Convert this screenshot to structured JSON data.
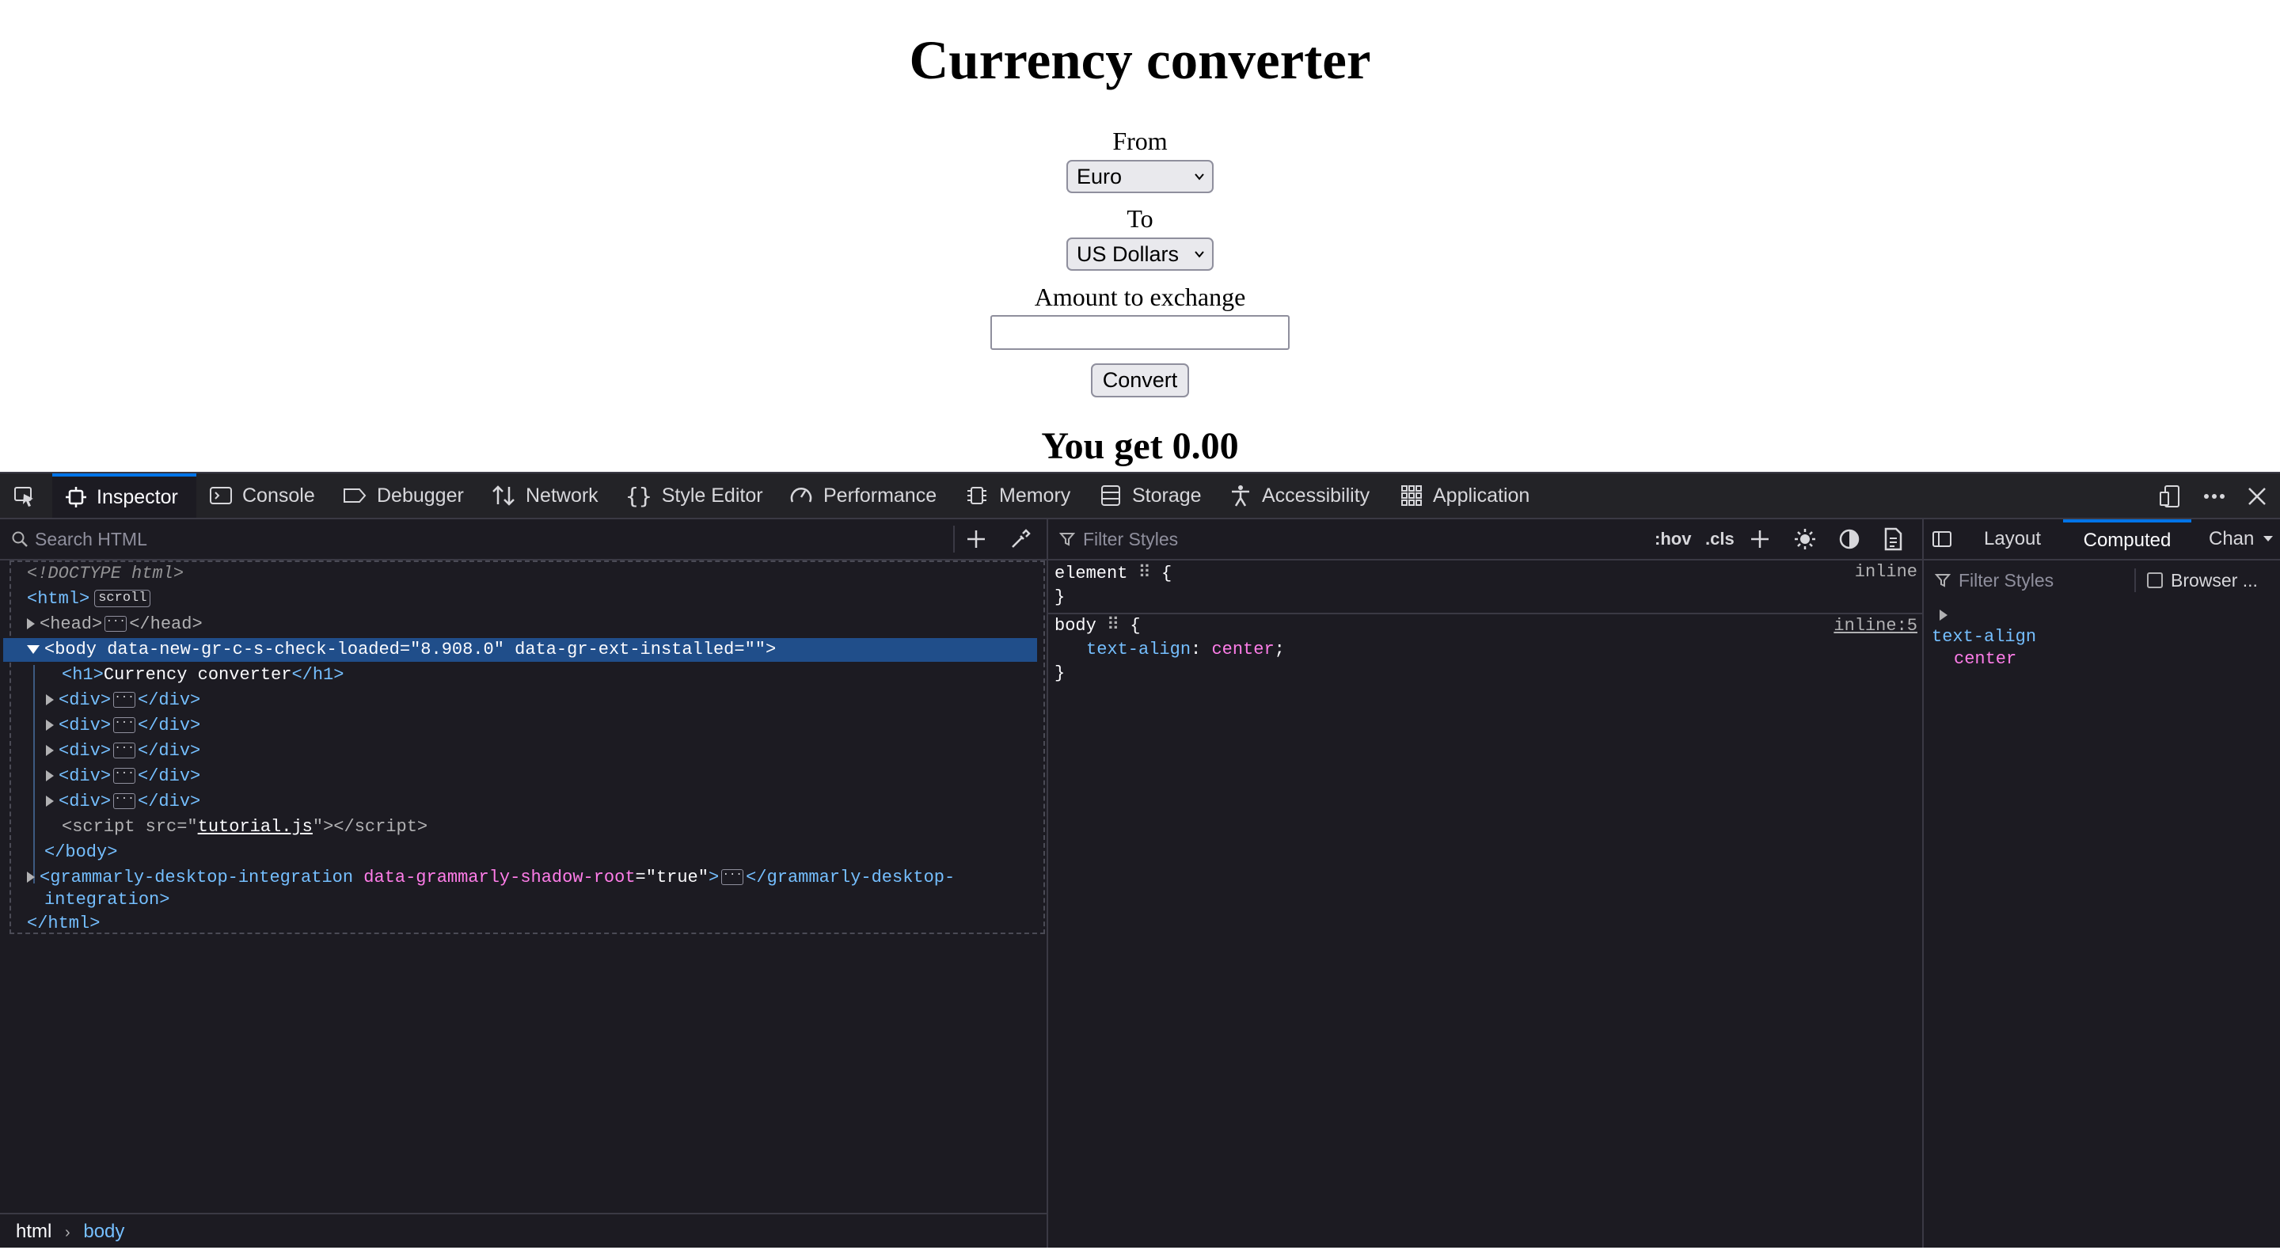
{
  "page": {
    "title": "Currency converter",
    "from_label": "From",
    "from_value": "Euro",
    "to_label": "To",
    "to_value": "US Dollars",
    "amount_label": "Amount to exchange",
    "amount_value": "",
    "convert_label": "Convert",
    "result": "You get 0.00"
  },
  "devtools": {
    "tabs": [
      "Inspector",
      "Console",
      "Debugger",
      "Network",
      "Style Editor",
      "Performance",
      "Memory",
      "Storage",
      "Accessibility",
      "Application"
    ],
    "active_tab": "Inspector",
    "search_placeholder": "Search HTML",
    "tree": {
      "doctype": "<!DOCTYPE html>",
      "html_tag": "html",
      "scroll_badge": "scroll",
      "head_tag": "head",
      "body_tag": "body",
      "body_attr1_name": "data-new-gr-c-s-check-loaded",
      "body_attr1_value": "8.908.0",
      "body_attr2_name": "data-gr-ext-installed",
      "body_attr2_value": "",
      "h1_tag": "h1",
      "h1_text": "Currency converter",
      "div_tag": "div",
      "script_tag": "script",
      "script_attr": "src",
      "script_src": "tutorial.js",
      "gram_tag": "grammarly-desktop-integration",
      "gram_tag_line2": "integration",
      "gram_attr_name": "data-grammarly-shadow-root",
      "gram_attr_value": "true"
    },
    "breadcrumbs": [
      "html",
      "body"
    ],
    "rules": {
      "filter_placeholder": "Filter Styles",
      "hov": ":hov",
      "cls": ".cls",
      "element_selector": "element",
      "element_source": "inline",
      "body_selector": "body",
      "body_source": "inline:5",
      "prop": "text-align",
      "value": "center"
    },
    "side": {
      "tabs": [
        "Layout",
        "Computed",
        "Chan"
      ],
      "active_tab": "Computed",
      "filter_placeholder": "Filter Styles",
      "browser_styles": "Browser ...",
      "computed_prop": "text-align",
      "computed_value": "center"
    }
  }
}
